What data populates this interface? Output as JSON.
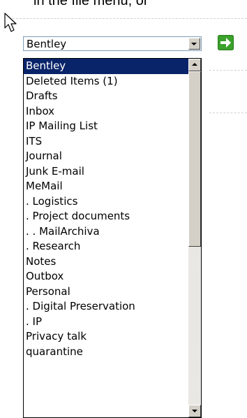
{
  "top_text": "in the file menu, or",
  "combo": {
    "selected": "Bentley",
    "dropdown_icon": "chevron-down-icon",
    "go_icon": "green-arrow-right-icon",
    "go_color": "#4caf2a"
  },
  "folders": [
    "Bentley",
    "Deleted Items (1)",
    "Drafts",
    "Inbox",
    "IP Mailing List",
    "ITS",
    "Journal",
    "Junk E-mail",
    "MeMail",
    ". Logistics",
    ". Project documents",
    ". . MailArchiva",
    ". Research",
    "Notes",
    "Outbox",
    "Personal",
    ". Digital Preservation",
    ". IP",
    "Privacy talk",
    "quarantine"
  ],
  "selected_index": 0,
  "colors": {
    "selection_bg": "#0a246a",
    "selection_fg": "#ffffff"
  }
}
